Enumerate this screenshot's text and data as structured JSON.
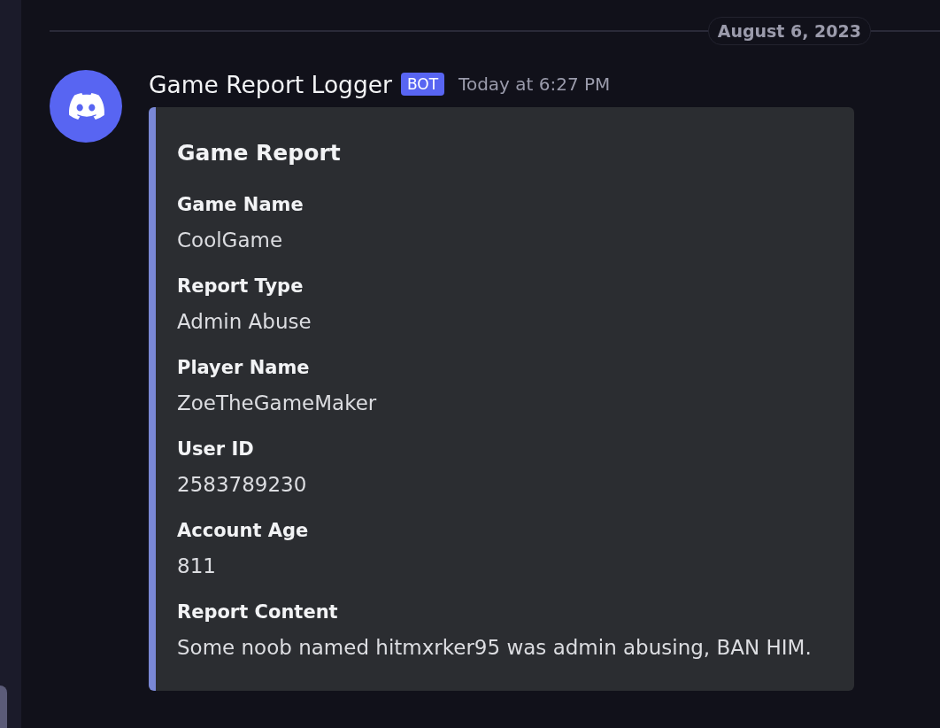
{
  "date_divider": {
    "label": "August 6, 2023"
  },
  "message": {
    "author": "Game Report Logger",
    "badge": "BOT",
    "timestamp": "Today at 6:27 PM",
    "embed": {
      "title": "Game Report",
      "fields": [
        {
          "name": "Game Name",
          "value": "CoolGame"
        },
        {
          "name": "Report Type",
          "value": "Admin Abuse"
        },
        {
          "name": "Player Name",
          "value": "ZoeTheGameMaker"
        },
        {
          "name": "User ID",
          "value": "2583789230"
        },
        {
          "name": "Account Age",
          "value": "811"
        },
        {
          "name": "Report Content",
          "value": "Some noob named hitmxrker95 was admin abusing, BAN HIM."
        }
      ]
    }
  }
}
